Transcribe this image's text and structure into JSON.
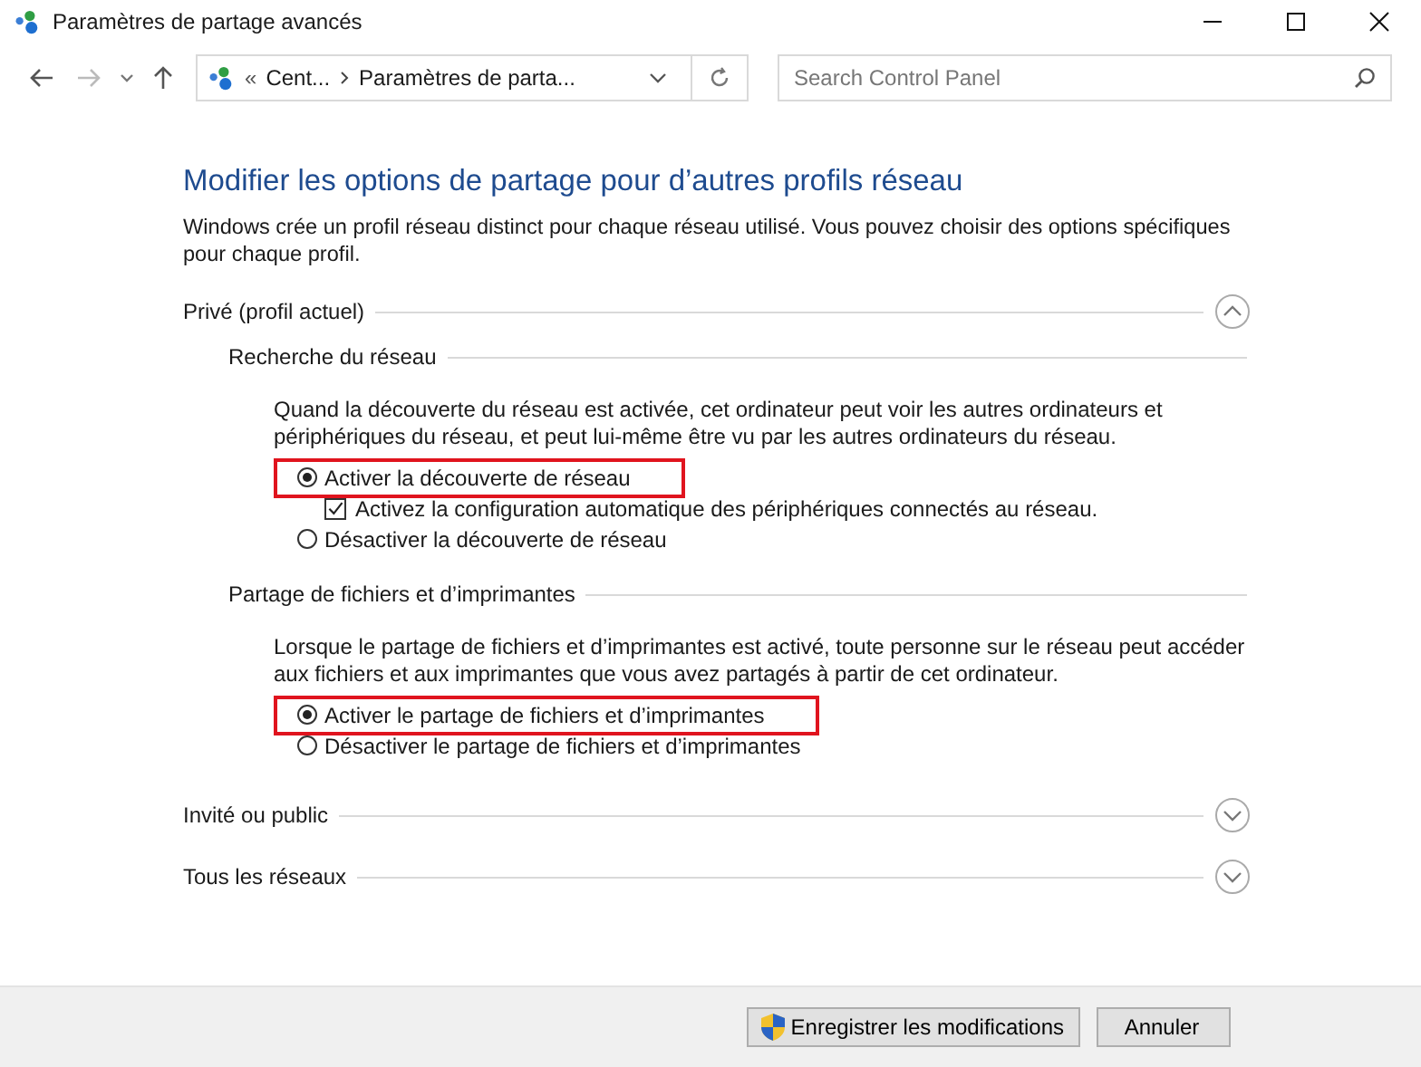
{
  "window": {
    "title": "Paramètres de partage avancés"
  },
  "address_bar": {
    "overflow": "«",
    "crumbs": [
      "Cent...",
      "Paramètres de parta..."
    ]
  },
  "search": {
    "placeholder": "Search Control Panel"
  },
  "heading": "Modifier les options de partage pour d’autres profils réseau",
  "intro": "Windows crée un profil réseau distinct pour chaque réseau utilisé. Vous pouvez choisir des options spécifiques pour chaque profil.",
  "profiles": [
    {
      "name": "Privé (profil actuel)",
      "expanded": true,
      "groups": [
        {
          "title": "Recherche du réseau",
          "description": "Quand la découverte du réseau est activée, cet ordinateur peut voir les autres ordinateurs et périphériques du réseau, et peut lui-même être vu par les autres ordinateurs du réseau.",
          "options": [
            {
              "kind": "radio",
              "label": "Activer la découverte de réseau",
              "selected": true,
              "highlighted": true,
              "children": [
                {
                  "kind": "checkbox",
                  "label": "Activez la configuration automatique des périphériques connectés au réseau.",
                  "checked": true
                }
              ]
            },
            {
              "kind": "radio",
              "label": "Désactiver la découverte de réseau",
              "selected": false,
              "highlighted": false
            }
          ]
        },
        {
          "title": "Partage de fichiers et d’imprimantes",
          "description": "Lorsque le partage de fichiers et d’imprimantes est activé, toute personne sur le réseau peut accéder aux fichiers et aux imprimantes que vous avez partagés à partir de cet ordinateur.",
          "options": [
            {
              "kind": "radio",
              "label": "Activer le partage de fichiers et d’imprimantes",
              "selected": true,
              "highlighted": true
            },
            {
              "kind": "radio",
              "label": "Désactiver le partage de fichiers et d’imprimantes",
              "selected": false,
              "highlighted": false
            }
          ]
        }
      ]
    },
    {
      "name": "Invité ou public",
      "expanded": false
    },
    {
      "name": "Tous les réseaux",
      "expanded": false
    }
  ],
  "buttons": [
    {
      "label": "Enregistrer les modifications",
      "shield": true
    },
    {
      "label": "Annuler",
      "shield": false
    }
  ]
}
